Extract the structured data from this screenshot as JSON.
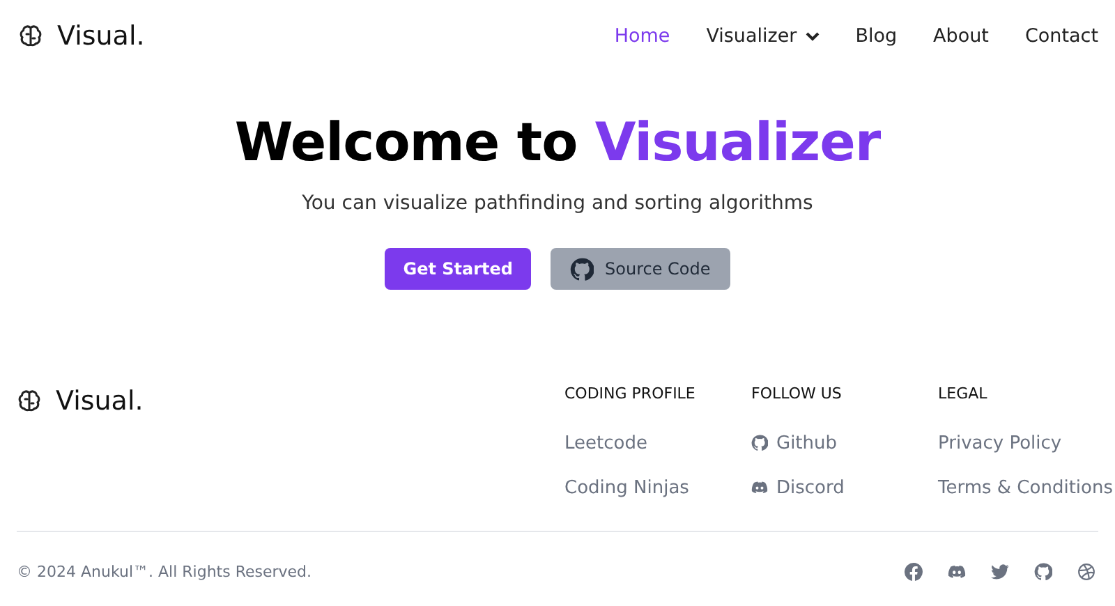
{
  "header": {
    "logo": "Visual.",
    "nav": [
      {
        "label": "Home",
        "selected": true,
        "kind": "link"
      },
      {
        "label": "Visualizer",
        "selected": false,
        "kind": "dropdown"
      },
      {
        "label": "Blog",
        "selected": false,
        "kind": "link"
      },
      {
        "label": "About",
        "selected": false,
        "kind": "link"
      },
      {
        "label": "Contact",
        "selected": false,
        "kind": "link"
      }
    ]
  },
  "hero": {
    "title": "Welcome to",
    "title_highlight": "Visualizer",
    "subtitle": "You can visualize pathfinding and sorting algorithms",
    "buttons": [
      {
        "label": "Get Started",
        "kind": "primary"
      },
      {
        "label": "Source Code",
        "kind": "github"
      }
    ]
  },
  "footer": {
    "logo": "Visual.",
    "columns": [
      {
        "heading": "CODING PROFILE",
        "links": [
          {
            "label": "Leetcode",
            "kind": "plain"
          },
          {
            "label": "Coding Ninjas",
            "kind": "plain"
          }
        ]
      },
      {
        "heading": "FOLLOW US",
        "links": [
          {
            "label": "Github",
            "kind": "github"
          },
          {
            "label": "Discord",
            "kind": "discord"
          }
        ]
      },
      {
        "heading": "LEGAL",
        "links": [
          {
            "label": "Privacy Policy",
            "kind": "plain"
          },
          {
            "label": "Terms & Conditions",
            "kind": "plain"
          }
        ]
      }
    ],
    "copyright": "© 2024 Anukul™. All Rights Reserved."
  }
}
